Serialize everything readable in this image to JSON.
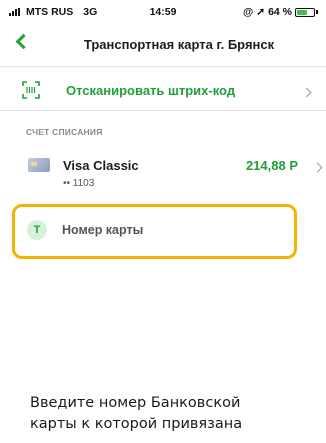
{
  "status_bar": {
    "carrier": "MTS RUS",
    "network": "3G",
    "time": "14:59",
    "battery_text": "64 %",
    "battery_level": 0.64
  },
  "nav": {
    "title": "Транспортная карта г. Брянск"
  },
  "scan": {
    "label": "Отсканировать штрих-код"
  },
  "debit": {
    "header": "СЧЕТ СПИСАНИЯ",
    "card_name": "Visa Classic",
    "card_number": "•• 1103",
    "balance": "214,88 Р"
  },
  "card_input": {
    "badge": "Т",
    "placeholder": "Номер карты"
  },
  "hint": {
    "line1": "Введите номер Банковской",
    "line2": "карты к которой привязана"
  },
  "colors": {
    "accent": "#21a038",
    "highlight": "#f2b400"
  },
  "icons": [
    "back-chevron-icon",
    "barcode-scan-icon",
    "bank-card-icon",
    "chevron-right-icon"
  ]
}
